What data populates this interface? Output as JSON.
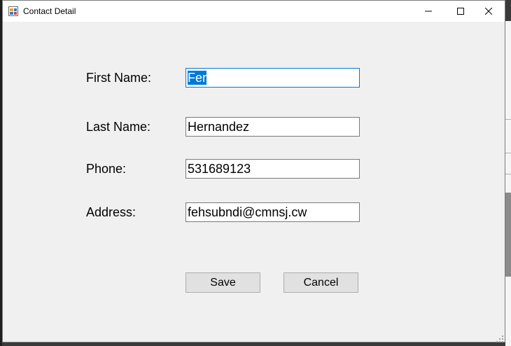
{
  "window": {
    "title": "Contact Detail"
  },
  "form": {
    "first_name_label": "First Name:",
    "first_name_value": "Fer",
    "last_name_label": "Last Name:",
    "last_name_value": "Hernandez",
    "phone_label": "Phone:",
    "phone_value": "531689123",
    "address_label": "Address:",
    "address_value": "fehsubndi@cmnsj.cw"
  },
  "buttons": {
    "save_label": "Save",
    "cancel_label": "Cancel"
  },
  "colors": {
    "selection": "#0078d7",
    "window_bg": "#f0f0f0",
    "button_bg": "#e1e1e1"
  },
  "icons": {
    "app": "form-app-icon",
    "minimize": "minimize-icon",
    "maximize": "maximize-icon",
    "close": "close-icon"
  }
}
